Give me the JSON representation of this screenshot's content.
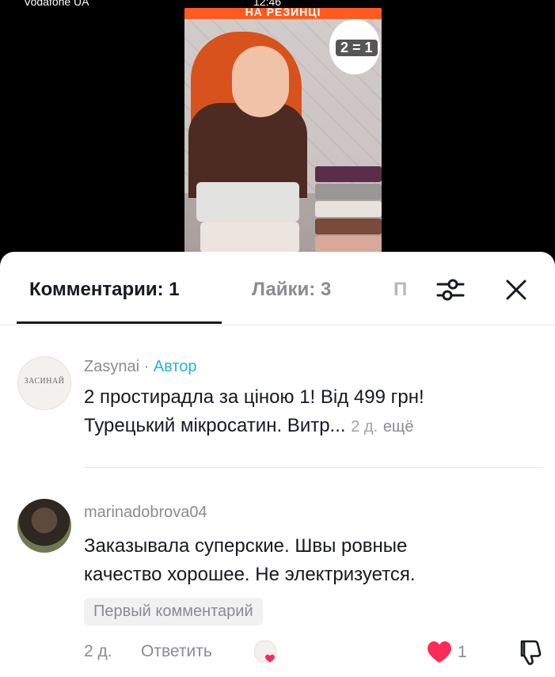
{
  "status_bar": {
    "left": "Vodafone UA",
    "time": "12:46"
  },
  "video": {
    "banner": "НА РЕЗИНЦІ",
    "badge": "2 = 1"
  },
  "tabs": {
    "comments": "Комментарии: 1",
    "likes": "Лайки: 3",
    "third": "П"
  },
  "comments": [
    {
      "username": "Zasynai",
      "author_sep": " · ",
      "author_label": "Автор",
      "avatar_text": "ЗАСИНАЙ",
      "text_line1": "2 простирадла за ціною 1! Від 499 грн!",
      "text_line2": "Турецький мікросатин. Витр...",
      "time": "2 д.",
      "more": "ещё"
    },
    {
      "username": "marinadobrova04",
      "text_line1": "Заказывала суперские. Швы ровные",
      "text_line2": "качество хорошее. Не электризуется.",
      "chip": "Первый комментарий",
      "time": "2 д.",
      "reply": "Ответить",
      "likes": "1"
    }
  ],
  "colors": {
    "author": "#20b8c8",
    "like": "#fe2c55",
    "text": "#161823",
    "muted": "#8a8b91"
  }
}
